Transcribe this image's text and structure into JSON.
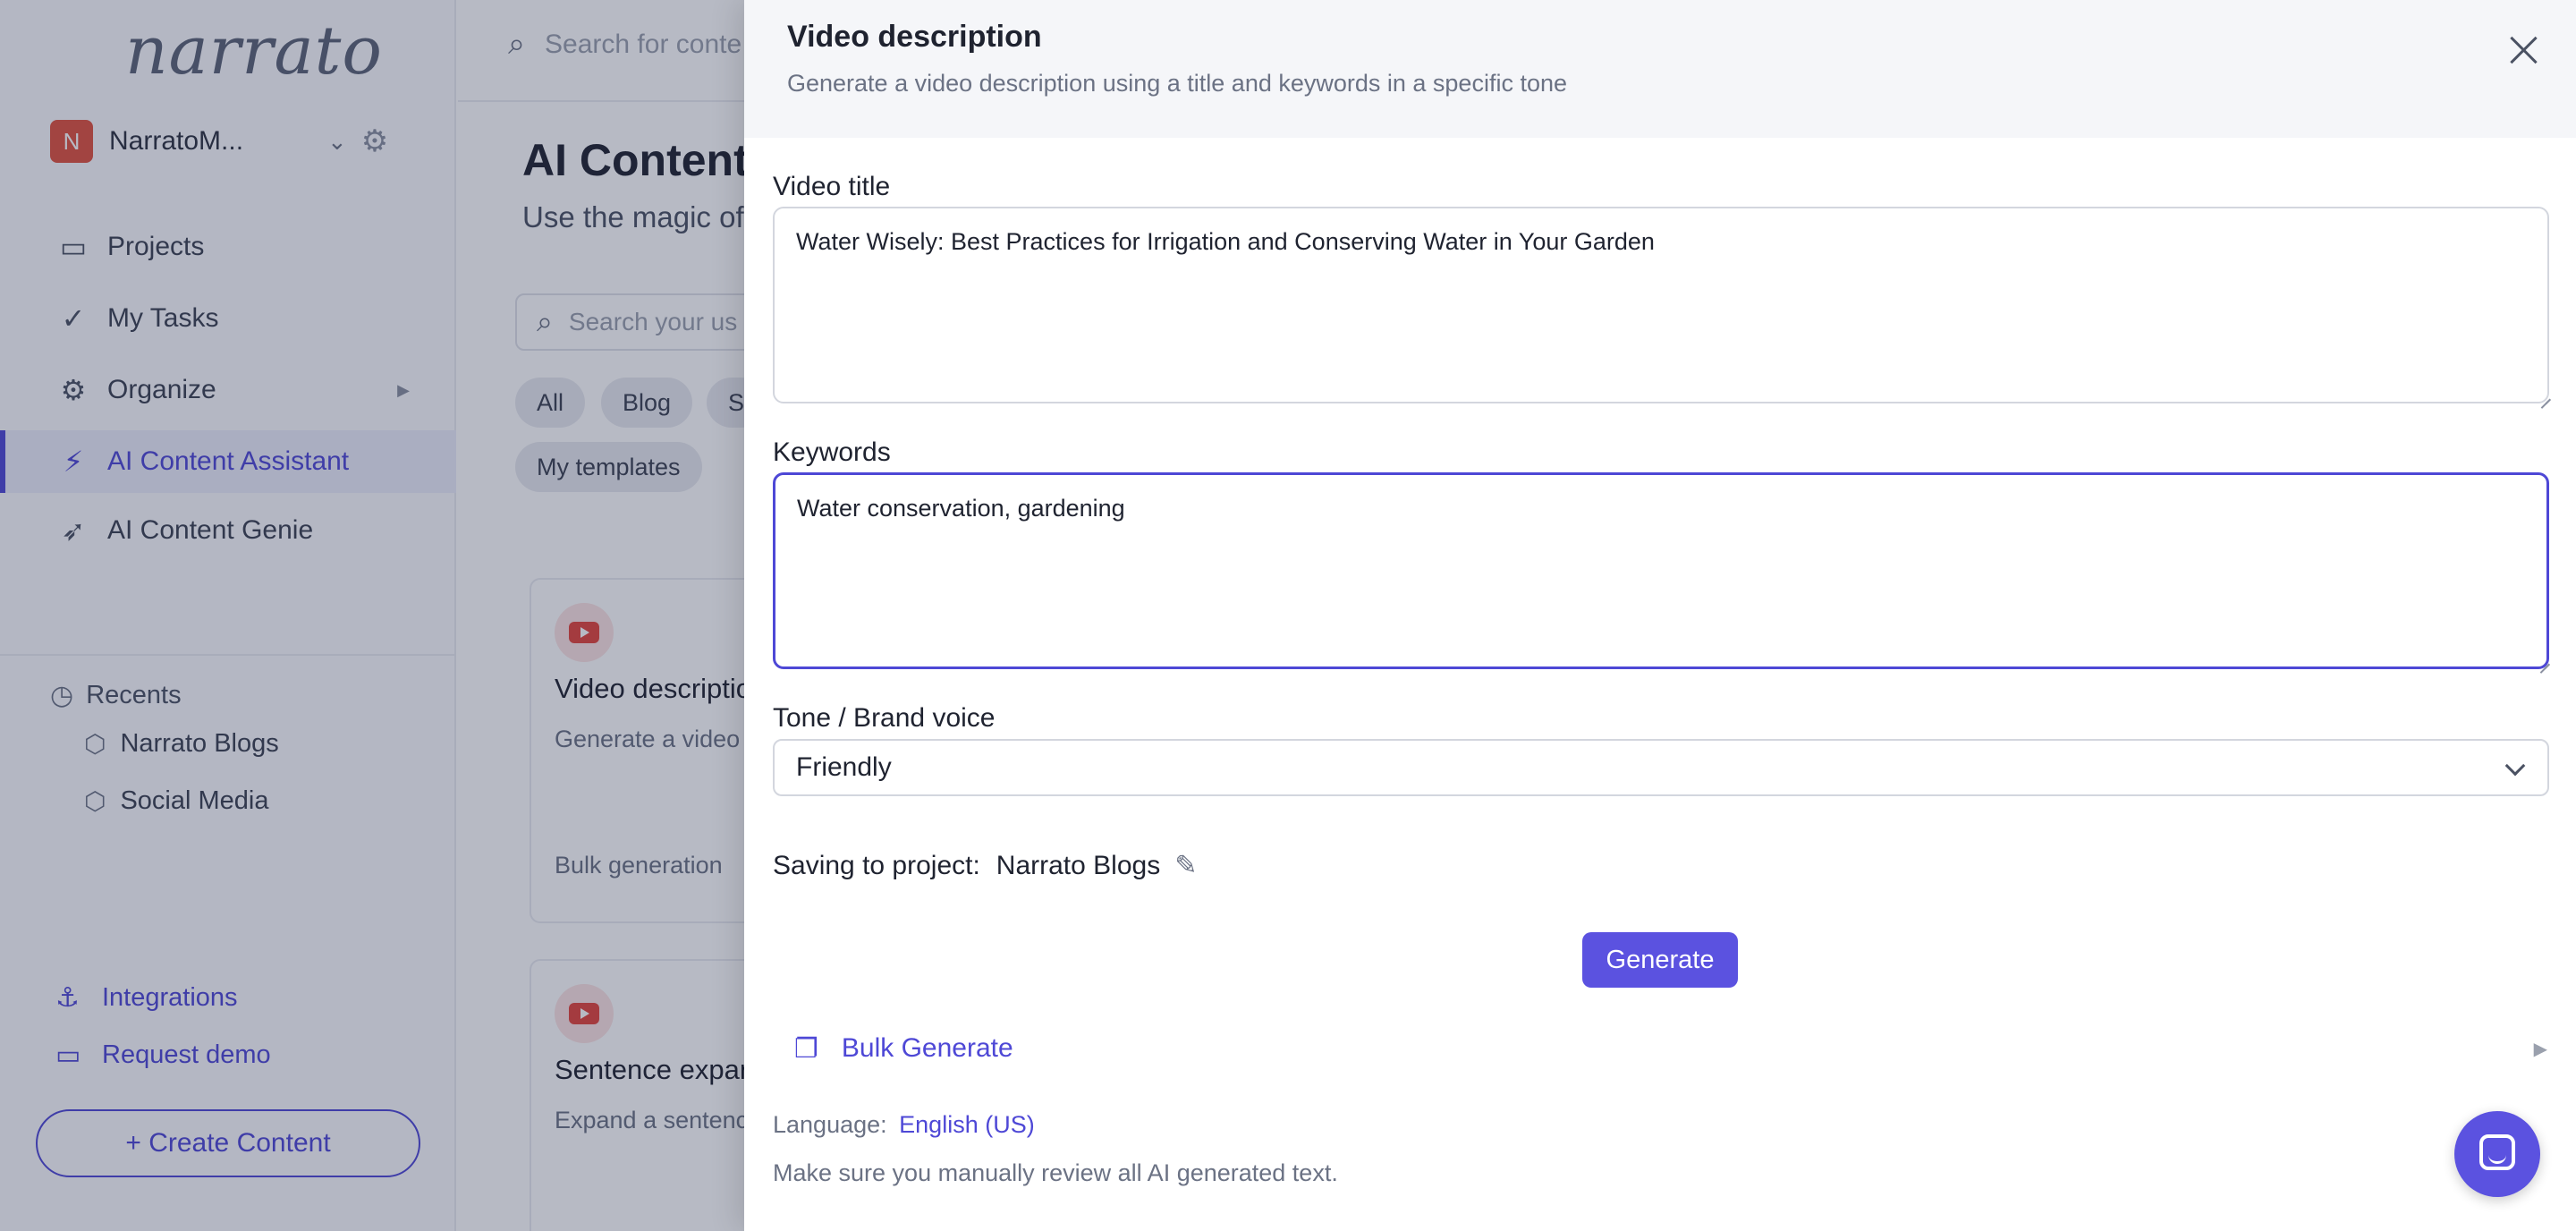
{
  "sidebar": {
    "logo": "narrato",
    "workspace": {
      "badge": "N",
      "name": "NarratoM..."
    },
    "nav": [
      {
        "label": "Projects"
      },
      {
        "label": "My Tasks"
      },
      {
        "label": "Organize"
      },
      {
        "label": "AI Content Assistant"
      },
      {
        "label": "AI Content Genie"
      }
    ],
    "recents_title": "Recents",
    "recents": [
      {
        "label": "Narrato Blogs"
      },
      {
        "label": "Social Media"
      }
    ],
    "integrations": "Integrations",
    "request_demo": "Request demo",
    "create_button": "+ Create Content"
  },
  "main": {
    "search_placeholder": "Search for conte",
    "title": "AI Content",
    "subtitle": "Use the magic of",
    "template_search_placeholder": "Search your us",
    "chips": [
      "All",
      "Blog",
      "S",
      "My templates"
    ],
    "cards": [
      {
        "title": "Video descriptio",
        "desc": "Generate a video title and keywords",
        "bulk": "Bulk generation"
      },
      {
        "title": "Sentence expan",
        "desc": "Expand a sentenc",
        "bulk": ""
      }
    ]
  },
  "drawer": {
    "title": "Video description",
    "subtitle": "Generate a video description using a title and keywords in a specific tone",
    "video_title_label": "Video title",
    "video_title_value": "Water Wisely: Best Practices for Irrigation and Conserving Water in Your Garden",
    "keywords_label": "Keywords",
    "keywords_value": "Water conservation, gardening",
    "tone_label": "Tone / Brand voice",
    "tone_value": "Friendly",
    "saving_label": "Saving to project:",
    "saving_project": "Narrato Blogs",
    "generate_button": "Generate",
    "bulk_generate": "Bulk Generate",
    "language_label": "Language:",
    "language_value": "English (US)",
    "review_note": "Make sure you manually review all AI generated text."
  },
  "colors": {
    "accent": "#5b52e0",
    "link": "#4e48d6",
    "badge": "#e0523f"
  }
}
